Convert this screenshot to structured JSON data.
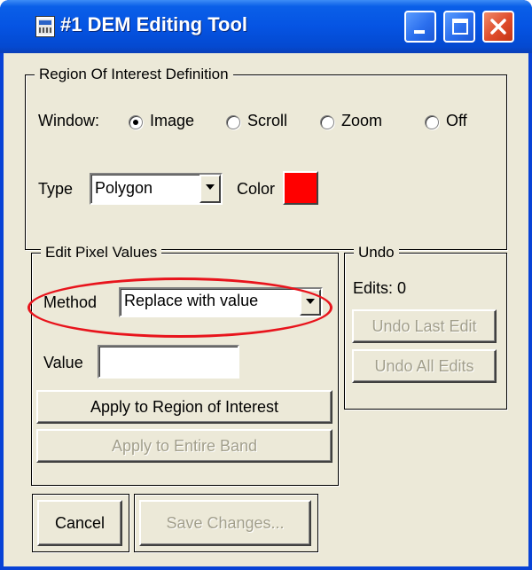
{
  "window": {
    "title": "#1 DEM Editing Tool",
    "controls": {
      "minimize": "minimize-icon",
      "maximize": "maximize-icon",
      "close": "close-icon"
    }
  },
  "roi": {
    "legend": "Region Of Interest Definition",
    "window_label": "Window:",
    "window_options": [
      "Image",
      "Scroll",
      "Zoom",
      "Off"
    ],
    "window_selected": "Image",
    "type_label": "Type",
    "type_value": "Polygon",
    "color_label": "Color",
    "color_value": "#ff0000"
  },
  "edit": {
    "legend": "Edit Pixel Values",
    "method_label": "Method",
    "method_value": "Replace with value",
    "value_label": "Value",
    "value_text": "",
    "apply_roi": "Apply to Region of Interest",
    "apply_band": "Apply to Entire Band"
  },
  "undo": {
    "legend": "Undo",
    "edits_text": "Edits: 0",
    "undo_last": "Undo Last Edit",
    "undo_all": "Undo All Edits"
  },
  "footer": {
    "cancel": "Cancel",
    "save": "Save Changes..."
  },
  "annotation": {
    "color": "#e8141c"
  }
}
